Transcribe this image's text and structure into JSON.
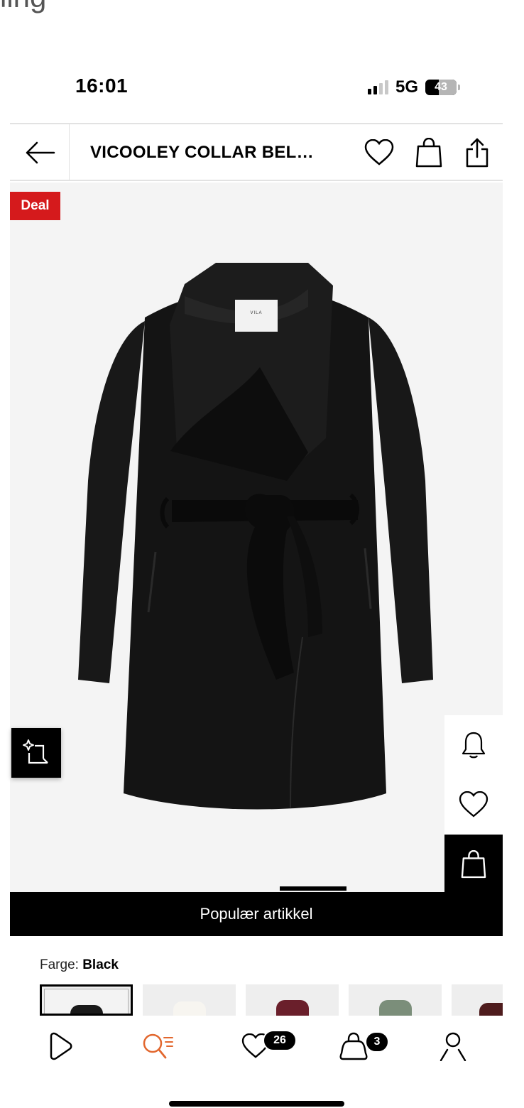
{
  "cut_text": "ling",
  "status_bar": {
    "time": "16:01",
    "network": "5G",
    "battery": "43",
    "battery_level": 0.43
  },
  "header": {
    "title": "VICOOLEY COLLAR BEL…",
    "icons": [
      "back-arrow-icon",
      "heart-icon",
      "shopping-bag-icon",
      "share-icon"
    ]
  },
  "product": {
    "deal_badge": "Deal",
    "label_brand": "VILA",
    "popular_label": "Populær artikkel",
    "colors": {
      "label": "Farge:",
      "selected": "Black",
      "swatches": [
        "#1a1a1a",
        "#f2f0ec",
        "#6a1f2b",
        "#7b8e7a",
        "#4e1c1d"
      ]
    }
  },
  "side_actions": [
    "bell-icon",
    "heart-icon",
    "shopping-bag-icon"
  ],
  "bottom_nav": {
    "wishlist_count": "26",
    "cart_count": "3"
  },
  "colors": {
    "deal_red": "#d51a1c",
    "search_orange": "#e2672e",
    "image_bg": "#f4f4f4"
  }
}
